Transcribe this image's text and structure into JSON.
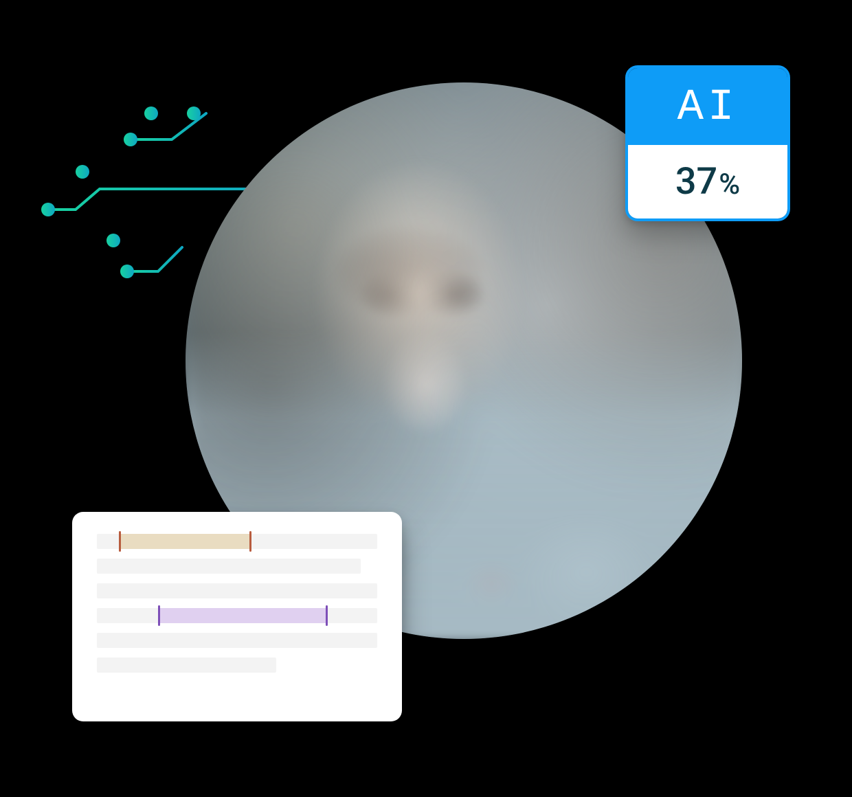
{
  "ai_badge": {
    "label": "AI",
    "value": "37",
    "unit": "%"
  },
  "colors": {
    "badge_blue": "#0e9cf7",
    "badge_text_dark": "#0e3a47",
    "circuit_teal1": "#14c8a6",
    "circuit_teal2": "#0fb0b6",
    "highlight_tan": "#e9dcc1",
    "highlight_purple": "#e0d0f0"
  },
  "photo": {
    "description": "man-with-glasses-at-laptop"
  }
}
